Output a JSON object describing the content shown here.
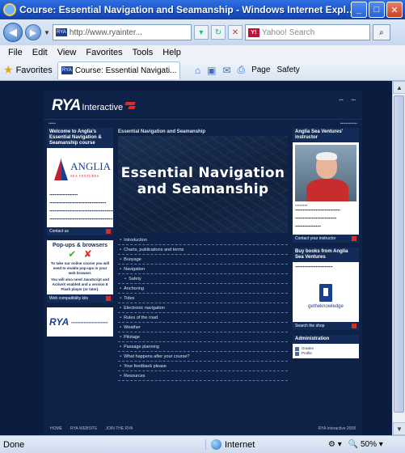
{
  "window": {
    "title": "Course: Essential Navigation and Seamanship - Windows Internet Explorer",
    "buttons": [
      "_",
      "□",
      "✕"
    ]
  },
  "address": {
    "url": "http://www.ryainter...",
    "search_placeholder": "Yahoo! Search"
  },
  "menu": [
    "File",
    "Edit",
    "View",
    "Favorites",
    "Tools",
    "Help"
  ],
  "favorites": {
    "label": "Favorites",
    "tab_title": "Course: Essential Navigati...",
    "page_label": "Page",
    "safety_label": "Safety"
  },
  "site": {
    "logo_text": "RYA",
    "logo_sub": "Interactive"
  },
  "left": {
    "welcome_title": "Welcome to Anglia's Essential Navigation & Seamanship course",
    "anglia_name": "ANGLIA",
    "anglia_tag": "SEA VENTURES",
    "contact_label": "Contact us",
    "popup_title": "Pop-ups & browsers",
    "popup_text1": "To take our online course you will need to enable pop-ups in your web browser.",
    "popup_text2": "You will also need JavaScript and ActiveX enabled and a version 8 Flash player (or later).",
    "compat_label": "Web compatibility kits",
    "rya_small": "RYA"
  },
  "middle": {
    "course_label": "Essential Navigation and Seamanship",
    "hero_title": "Essential Navigation and Seamanship",
    "items": [
      {
        "label": "Introduction",
        "sub": false
      },
      {
        "label": "Charts, publications and terms",
        "sub": false
      },
      {
        "label": "Buoyage",
        "sub": false
      },
      {
        "label": "Navigation",
        "sub": false
      },
      {
        "label": "Safety",
        "sub": true
      },
      {
        "label": "Anchoring",
        "sub": false
      },
      {
        "label": "Tides",
        "sub": false
      },
      {
        "label": "Electronic navigation",
        "sub": false
      },
      {
        "label": "Rules of the road",
        "sub": false
      },
      {
        "label": "Weather",
        "sub": false
      },
      {
        "label": "Pilotage",
        "sub": false
      },
      {
        "label": "Passage planning",
        "sub": false
      },
      {
        "label": "What happens after your course?",
        "sub": false
      },
      {
        "label": "Your feedback please",
        "sub": false
      },
      {
        "label": "Resources",
        "sub": false
      }
    ]
  },
  "right": {
    "instructor_title": "Anglia Sea Ventures' instructor",
    "contact_instructor": "Contact your instructor",
    "books_title": "Buy books from Anglia Sea Ventures",
    "gtk_label": "getheknowledge",
    "shop_label": "Search the shop",
    "admin_title": "Administration",
    "admin_items": [
      "Grades",
      "Profile"
    ]
  },
  "footer": {
    "links": [
      "HOME",
      "RYA WEBSITE",
      "JOIN THE RYA"
    ],
    "copyright": "RYA Interactive 2008"
  },
  "status": {
    "done": "Done",
    "zone": "Internet",
    "zoom": "50%"
  }
}
